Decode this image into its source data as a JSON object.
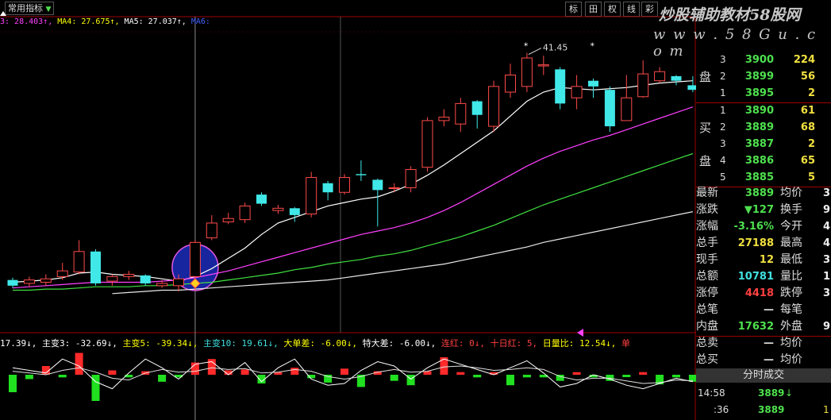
{
  "toolbar": {
    "indicator_select": "常用指标",
    "tab_biao": "标",
    "tab_grid": "田",
    "tab_quan": "权",
    "tab_xian": "线",
    "tab_more": "彩"
  },
  "watermark": {
    "line1": "炒股辅助教材58股网",
    "line2": "w w w . 5 8 G u . c o m"
  },
  "ma_legend": [
    {
      "text": "3: 28.403↑,",
      "color": "#ff40ff"
    },
    {
      "text": " MA4: 27.675↑,",
      "color": "#ffff00"
    },
    {
      "text": " MA5: 27.037↑,",
      "color": "#ffffff"
    },
    {
      "text": " MA6:",
      "color": "#4060ff"
    }
  ],
  "indicator_legend": [
    {
      "text": "17.39↓,",
      "color": "#ffffff"
    },
    {
      "text": " 主变3: -32.69↓,",
      "color": "#ffffff"
    },
    {
      "text": " 主变5: -39.34↓,",
      "color": "#ffff00"
    },
    {
      "text": " 主变10: 19.61↓,",
      "color": "#40e0e0"
    },
    {
      "text": " 大单差: -6.00↓,",
      "color": "#ffff00"
    },
    {
      "text": " 特大差: -6.00↓,",
      "color": "#ffffff"
    },
    {
      "text": " 连红: 0↓,",
      "color": "#ff4040"
    },
    {
      "text": " 十日红: 5,",
      "color": "#ff4040"
    },
    {
      "text": " 日量比: 12.54↓,",
      "color": "#ffff00"
    },
    {
      "text": " 单",
      "color": "#ff4040"
    }
  ],
  "chart_data": {
    "type": "candlestick",
    "high_label": "41.45",
    "candles": [
      {
        "o": 21.5,
        "c": 21.0,
        "h": 21.7,
        "l": 20.8
      },
      {
        "o": 21.2,
        "c": 21.5,
        "h": 21.8,
        "l": 20.9
      },
      {
        "o": 21.3,
        "c": 21.6,
        "h": 22.0,
        "l": 21.0
      },
      {
        "o": 21.8,
        "c": 22.3,
        "h": 23.0,
        "l": 21.5
      },
      {
        "o": 22.2,
        "c": 24.0,
        "h": 25.0,
        "l": 22.0
      },
      {
        "o": 24.0,
        "c": 21.2,
        "h": 24.2,
        "l": 21.0
      },
      {
        "o": 21.4,
        "c": 21.8,
        "h": 22.0,
        "l": 21.0
      },
      {
        "o": 21.8,
        "c": 22.0,
        "h": 22.3,
        "l": 21.5
      },
      {
        "o": 21.9,
        "c": 21.2,
        "h": 22.0,
        "l": 21.0
      },
      {
        "o": 21.0,
        "c": 21.2,
        "h": 21.5,
        "l": 20.8
      },
      {
        "o": 21.0,
        "c": 21.6,
        "h": 22.0,
        "l": 20.5
      },
      {
        "o": 21.8,
        "c": 24.8,
        "h": 25.0,
        "l": 20.6
      },
      {
        "o": 25.2,
        "c": 26.5,
        "h": 27.2,
        "l": 25.0
      },
      {
        "o": 26.6,
        "c": 26.9,
        "h": 27.4,
        "l": 26.4
      },
      {
        "o": 26.8,
        "c": 28.0,
        "h": 28.3,
        "l": 26.5
      },
      {
        "o": 29.0,
        "c": 28.2,
        "h": 29.2,
        "l": 28.0
      },
      {
        "o": 27.6,
        "c": 27.8,
        "h": 28.1,
        "l": 27.3
      },
      {
        "o": 27.8,
        "c": 27.2,
        "h": 27.9,
        "l": 26.6
      },
      {
        "o": 27.3,
        "c": 30.5,
        "h": 31.0,
        "l": 27.0
      },
      {
        "o": 30.0,
        "c": 29.2,
        "h": 30.2,
        "l": 28.5
      },
      {
        "o": 29.2,
        "c": 30.5,
        "h": 30.8,
        "l": 29.0
      },
      {
        "o": 30.8,
        "c": 30.7,
        "h": 32.0,
        "l": 30.2
      },
      {
        "o": 30.3,
        "c": 29.4,
        "h": 30.4,
        "l": 26.2
      },
      {
        "o": 29.6,
        "c": 29.6,
        "h": 30.0,
        "l": 29.2
      },
      {
        "o": 29.6,
        "c": 31.2,
        "h": 31.5,
        "l": 29.2
      },
      {
        "o": 31.4,
        "c": 35.5,
        "h": 35.8,
        "l": 31.0
      },
      {
        "o": 35.5,
        "c": 35.8,
        "h": 36.5,
        "l": 35.0
      },
      {
        "o": 35.2,
        "c": 37.0,
        "h": 37.5,
        "l": 34.5
      },
      {
        "o": 37.2,
        "c": 36.0,
        "h": 37.3,
        "l": 34.8
      },
      {
        "o": 35.0,
        "c": 38.5,
        "h": 39.0,
        "l": 34.5
      },
      {
        "o": 38.0,
        "c": 39.5,
        "h": 40.5,
        "l": 37.5
      },
      {
        "o": 38.5,
        "c": 41.0,
        "h": 41.45,
        "l": 38.0
      },
      {
        "o": 40.3,
        "c": 40.4,
        "h": 41.2,
        "l": 39.5
      },
      {
        "o": 40.0,
        "c": 37.0,
        "h": 40.2,
        "l": 36.5
      },
      {
        "o": 37.5,
        "c": 38.5,
        "h": 39.5,
        "l": 36.5
      },
      {
        "o": 39.0,
        "c": 38.5,
        "h": 39.2,
        "l": 37.5
      },
      {
        "o": 38.2,
        "c": 35.0,
        "h": 38.5,
        "l": 34.5
      },
      {
        "o": 35.5,
        "c": 37.5,
        "h": 39.5,
        "l": 35.5
      },
      {
        "o": 37.6,
        "c": 39.6,
        "h": 40.8,
        "l": 37.5
      },
      {
        "o": 39.0,
        "c": 39.8,
        "h": 40.2,
        "l": 38.8
      },
      {
        "o": 39.4,
        "c": 39.0,
        "h": 39.5,
        "l": 38.6
      },
      {
        "o": 38.6,
        "c": 38.2,
        "h": 39.4,
        "l": 38.0
      }
    ],
    "ma_lines": [
      {
        "name": "MA",
        "color": "#ffffff",
        "values": [
          21.3,
          21.4,
          21.5,
          21.7,
          22.1,
          22.2,
          22.0,
          21.9,
          21.8,
          21.6,
          21.4,
          21.8,
          22.5,
          23.4,
          24.3,
          25.5,
          26.5,
          27.0,
          27.5,
          28.0,
          28.3,
          28.6,
          28.8,
          29.3,
          29.9,
          30.7,
          31.6,
          32.6,
          33.6,
          34.6,
          35.9,
          37.2,
          38.0,
          38.4,
          38.3,
          38.2,
          38.3,
          38.4,
          38.6,
          38.8,
          38.9,
          39.0
        ]
      },
      {
        "name": "MA",
        "color": "#ff40ff",
        "values": [
          20.8,
          20.9,
          21.0,
          21.1,
          21.2,
          21.3,
          21.3,
          21.3,
          21.3,
          21.4,
          21.5,
          21.7,
          22.0,
          22.3,
          22.7,
          23.1,
          23.5,
          23.9,
          24.3,
          24.7,
          25.1,
          25.5,
          25.8,
          26.1,
          26.5,
          27.0,
          27.6,
          28.3,
          29.1,
          29.9,
          30.7,
          31.5,
          32.2,
          32.8,
          33.3,
          33.8,
          34.2,
          34.7,
          35.2,
          35.7,
          36.2,
          36.7
        ]
      },
      {
        "name": "MA",
        "color": "#40e040",
        "values": [
          20.6,
          20.6,
          20.7,
          20.7,
          20.8,
          20.9,
          20.9,
          20.9,
          21.0,
          21.0,
          21.1,
          21.2,
          21.3,
          21.5,
          21.7,
          21.9,
          22.1,
          22.4,
          22.6,
          22.9,
          23.1,
          23.3,
          23.6,
          23.8,
          24.1,
          24.5,
          24.9,
          25.3,
          25.8,
          26.3,
          26.9,
          27.5,
          28.1,
          28.6,
          29.1,
          29.6,
          30.1,
          30.6,
          31.1,
          31.6,
          32.1,
          32.6
        ]
      },
      {
        "name": "MA",
        "color": "#e8e8e8",
        "values": [
          null,
          null,
          null,
          null,
          null,
          null,
          20.3,
          20.4,
          20.5,
          20.6,
          20.6,
          20.7,
          20.8,
          20.9,
          21.0,
          21.1,
          21.2,
          21.3,
          21.4,
          21.5,
          21.7,
          21.9,
          22.1,
          22.3,
          22.5,
          22.7,
          22.9,
          23.2,
          23.5,
          23.8,
          24.1,
          24.4,
          24.8,
          25.1,
          25.4,
          25.7,
          26.0,
          26.3,
          26.6,
          26.9,
          27.2,
          27.5
        ]
      }
    ],
    "indicator_bars": [
      -2,
      -0.5,
      1,
      -0.3,
      2.5,
      -3,
      0.5,
      -0.3,
      0.4,
      -0.8,
      -0.3,
      1.4,
      1.8,
      0.5,
      0.6,
      -1,
      0.3,
      0.8,
      -0.4,
      -0.9,
      0.7,
      -1.4,
      0.4,
      -0.7,
      -1.2,
      0.4,
      2,
      0.3,
      -0.3,
      0.3,
      -1.2,
      -0.3,
      -0.3,
      -0.7,
      0.3,
      -0.3,
      -0.7,
      -0.2,
      0.3,
      -1.1,
      -0.3,
      -0.8
    ],
    "indicator_line1": [
      0.8,
      0.5,
      0.2,
      1.8,
      1.0,
      -0.8,
      -1.6,
      0.2,
      1.8,
      0.8,
      -0.5,
      1.2,
      1.5,
      0.0,
      1.4,
      -0.8,
      0.8,
      1.8,
      -0.5,
      -1.2,
      -1.0,
      0.5,
      1.5,
      1.0,
      -0.5,
      0.8,
      1.8,
      1.2,
      0.6,
      0.0,
      0.8,
      1.6,
      0.2,
      -1.4,
      -1.0,
      0.0,
      -0.5,
      -1.2,
      -1.6,
      -1.0,
      -0.4,
      -0.8
    ],
    "indicator_line2": [
      0.4,
      0.2,
      0.0,
      0.5,
      0.8,
      0.3,
      -0.4,
      -0.6,
      0.2,
      0.6,
      0.3,
      0.4,
      0.8,
      0.6,
      0.7,
      0.2,
      0.3,
      0.6,
      0.4,
      -0.2,
      -0.5,
      -0.2,
      0.3,
      0.6,
      0.3,
      0.4,
      0.9,
      1.0,
      0.8,
      0.5,
      0.6,
      0.8,
      0.6,
      -0.2,
      -0.6,
      -0.4,
      -0.4,
      -0.7,
      -1.0,
      -0.9,
      -0.6,
      -0.7
    ]
  },
  "order_book": {
    "sell_label_top": "盘",
    "buy_label_1": "买",
    "buy_label_2": "盘",
    "sells": [
      {
        "level": "3",
        "price": "3900",
        "vol": "224"
      },
      {
        "level": "2",
        "price": "3899",
        "vol": "56"
      },
      {
        "level": "1",
        "price": "3895",
        "vol": "2"
      }
    ],
    "buys": [
      {
        "level": "1",
        "price": "3890",
        "vol": "61"
      },
      {
        "level": "2",
        "price": "3889",
        "vol": "68"
      },
      {
        "level": "3",
        "price": "3887",
        "vol": "2"
      },
      {
        "level": "4",
        "price": "3886",
        "vol": "65"
      },
      {
        "level": "5",
        "price": "3885",
        "vol": "5"
      }
    ]
  },
  "quote": [
    {
      "l": "最新",
      "v": "3889",
      "vc": "#4ee04e",
      "l2": "均价",
      "v2": "3"
    },
    {
      "l": "涨跌",
      "v": "▼127",
      "vc": "#4ee04e",
      "l2": "换手",
      "v2": "9."
    },
    {
      "l": "涨幅",
      "v": "-3.16%",
      "vc": "#4ee04e",
      "l2": "今开",
      "v2": "4"
    },
    {
      "l": "总手",
      "v": "27188",
      "vc": "#f0e040",
      "l2": "最高",
      "v2": "4"
    },
    {
      "l": "现手",
      "v": "12",
      "vc": "#f0e040",
      "l2": "最低",
      "v2": "3"
    },
    {
      "l": "总额",
      "v": "10781",
      "vc": "#40e0e0",
      "l2": "量比",
      "v2": "1"
    },
    {
      "l": "涨停",
      "v": "4418",
      "vc": "#ff4040",
      "l2": "跌停",
      "v2": "3"
    },
    {
      "l": "总笔",
      "v": "—",
      "vc": "#ddd",
      "l2": "每笔",
      "v2": ""
    },
    {
      "l": "内盘",
      "v": "17632",
      "vc": "#4ee04e",
      "l2": "外盘",
      "v2": "9"
    },
    {
      "l": "总卖",
      "v": "—",
      "vc": "#ddd",
      "l2": "均价",
      "v2": ""
    },
    {
      "l": "总买",
      "v": "—",
      "vc": "#ddd",
      "l2": "均价",
      "v2": ""
    }
  ],
  "trades": {
    "header": "分时成交",
    "rows": [
      {
        "time": "14:58",
        "price": "3889",
        "arrow": "↓",
        "vol": ""
      },
      {
        "time": ":36",
        "price": "3889",
        "arrow": "",
        "vol": "1"
      }
    ]
  }
}
